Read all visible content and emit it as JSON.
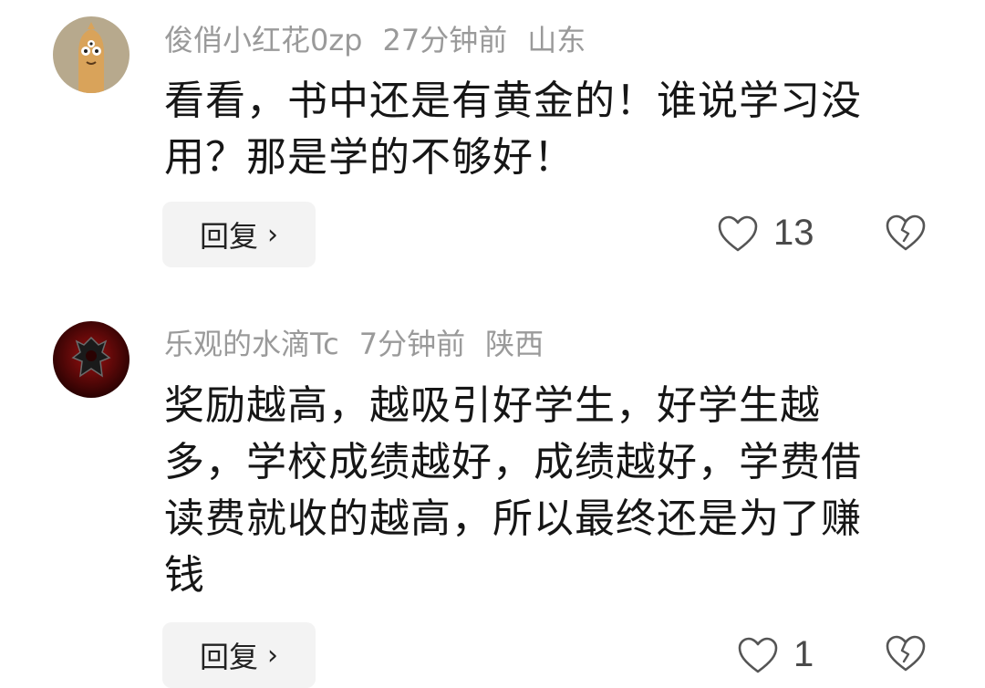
{
  "comments": [
    {
      "username": "俊俏小红花0zp",
      "time": "27分钟前",
      "location": "山东",
      "text": "看看，书中还是有黄金的！谁说学习没用？那是学的不够好！",
      "reply_label": "回复",
      "reply_chevron": "›",
      "likes": "13",
      "avatar_icon": "cartoon-character-avatar",
      "avatar_color": "#b7a98d"
    },
    {
      "username": "乐观的水滴Tc",
      "time": "7分钟前",
      "location": "陕西",
      "text": "奖励越高，越吸引好学生，好学生越多，学校成绩越好，成绩越好，学费借读费就收的越高，所以最终还是为了赚钱",
      "reply_label": "回复",
      "reply_chevron": "›",
      "likes": "1",
      "avatar_icon": "horde-emblem-avatar",
      "avatar_color": "#5a0a0a"
    }
  ],
  "colors": {
    "meta_text": "#9a9a9a",
    "body_text": "#161616",
    "reply_bg": "#f3f3f3",
    "icon_stroke": "#555555"
  }
}
